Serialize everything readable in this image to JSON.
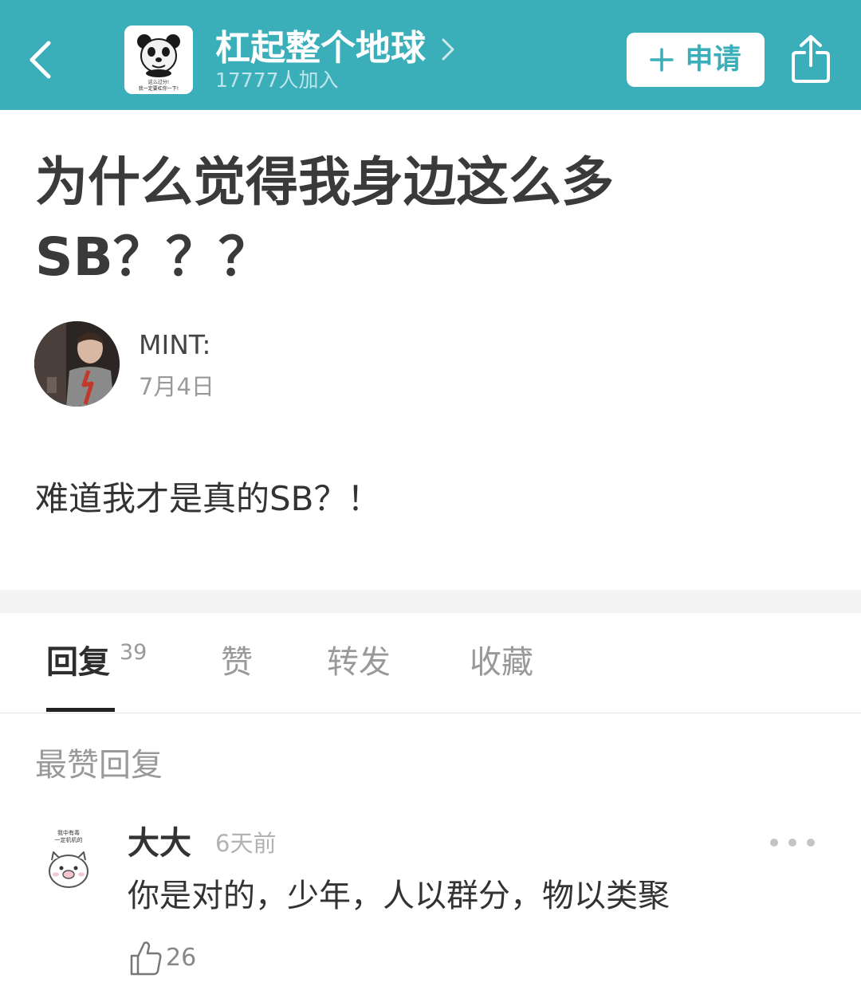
{
  "header": {
    "back_icon": "chevron-left-icon",
    "group": {
      "name": "杠起整个地球",
      "members": "17777人加入",
      "avatar_caption_line1": "这么过分!",
      "avatar_caption_line2": "我一定要杠你一下!"
    },
    "apply_label": "申请",
    "apply_icon": "plus-icon",
    "share_icon": "share-icon",
    "accent_color": "#3aafb9"
  },
  "post": {
    "title_line1": "为什么觉得我身边这么多",
    "title_line2": "SB？？？",
    "author": "MINT:",
    "date": "7月4日",
    "body": "难道我才是真的SB？！"
  },
  "tabs": [
    {
      "label": "回复",
      "count": "39",
      "active": true
    },
    {
      "label": "赞"
    },
    {
      "label": "转发"
    },
    {
      "label": "收藏"
    }
  ],
  "section_label": "最赞回复",
  "reply": {
    "user": "大大",
    "time": "6天前",
    "text": "你是对的，少年，人以群分，物以类聚",
    "likes": "26",
    "avatar_caption_line1": "我中有毒",
    "avatar_caption_line2": "一定机机的",
    "more_icon": "more-dots-icon",
    "like_icon": "thumbs-up-icon"
  }
}
